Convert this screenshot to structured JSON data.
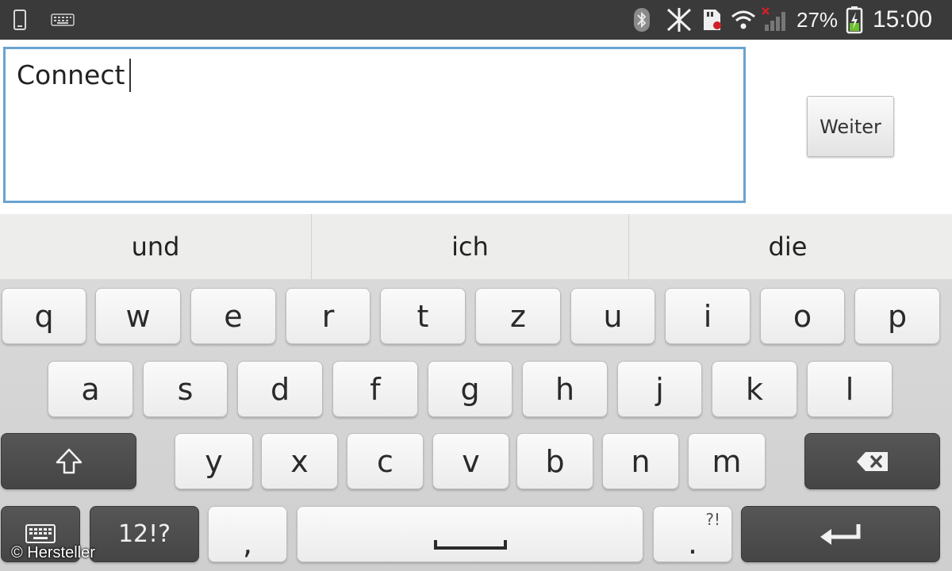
{
  "status_bar": {
    "left_icons": [
      "phone-icon",
      "keyboard-icon"
    ],
    "right_icons": [
      "bluetooth-icon",
      "nfc-off-icon",
      "sd-card-icon",
      "wifi-icon",
      "no-signal-icon",
      "battery-charging-icon"
    ],
    "battery_percent": "27%",
    "time": "15:00"
  },
  "text_field": {
    "value": "Connect"
  },
  "next_button": {
    "label": "Weiter"
  },
  "suggestions": [
    "und",
    "ich",
    "die"
  ],
  "keyboard": {
    "row1": [
      "q",
      "w",
      "e",
      "r",
      "t",
      "z",
      "u",
      "i",
      "o",
      "p"
    ],
    "row2": [
      "a",
      "s",
      "d",
      "f",
      "g",
      "h",
      "j",
      "k",
      "l"
    ],
    "row3": [
      "y",
      "x",
      "c",
      "v",
      "b",
      "n",
      "m"
    ],
    "symbols_label": "12!?",
    "comma_label": ",",
    "period_label": ".",
    "period_hint": "?!",
    "icons": {
      "shift": "shift-arrow-icon",
      "backspace": "backspace-icon",
      "keyboard_switch": "keyboard-icon",
      "space": "space-bar-icon",
      "enter": "enter-arrow-icon"
    }
  },
  "watermark": "© Hersteller",
  "colors": {
    "status_bar": "#3a3a3a",
    "input_border": "#6aa3cf",
    "keyboard_bg": "#d4d4d4",
    "key_light": "#f5f5f5",
    "key_dark": "#4d4d4d"
  }
}
